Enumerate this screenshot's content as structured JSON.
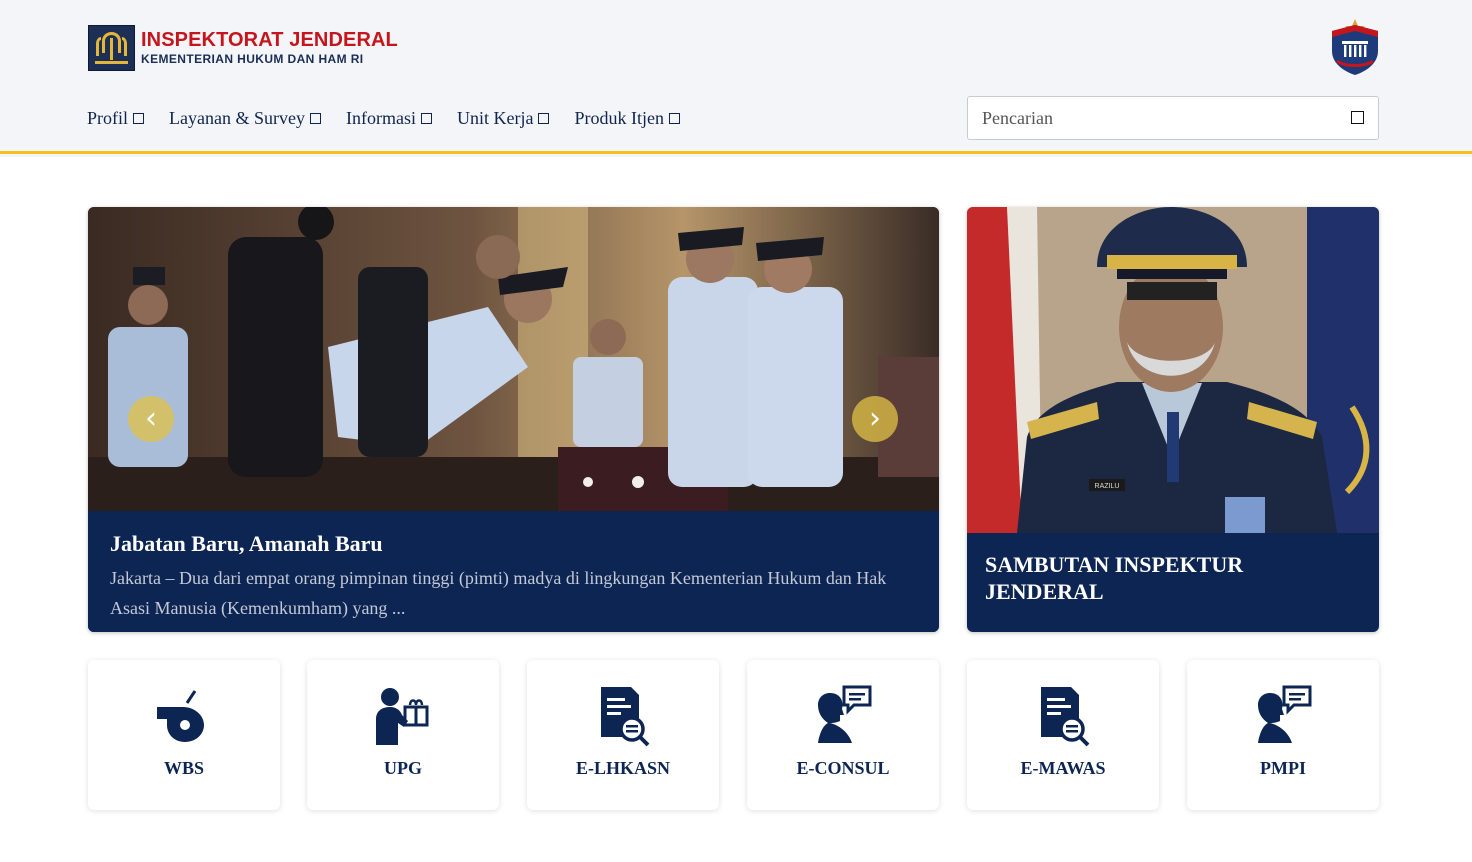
{
  "header": {
    "brand_title": "INSPEKTORAT JENDERAL",
    "brand_subtitle": "KEMENTERIAN HUKUM DAN HAM RI"
  },
  "nav": [
    {
      "label": "Profil"
    },
    {
      "label": "Layanan & Survey"
    },
    {
      "label": "Informasi"
    },
    {
      "label": "Unit Kerja"
    },
    {
      "label": "Produk Itjen"
    }
  ],
  "search": {
    "placeholder": "Pencarian",
    "value": ""
  },
  "hero": {
    "title": "Jabatan Baru, Amanah Baru",
    "excerpt": "Jakarta – Dua dari empat orang pimpinan tinggi (pimti) madya di lingkungan Kementerian Hukum dan Hak Asasi Manusia (Kemenkumham) yang ..."
  },
  "welcome": {
    "title": "SAMBUTAN INSPEKTUR JENDERAL",
    "name_tag": "RAZILU"
  },
  "services": [
    {
      "label": "WBS",
      "icon": "whistle-icon"
    },
    {
      "label": "UPG",
      "icon": "person-gift-icon"
    },
    {
      "label": "E-LHKASN",
      "icon": "document-search-icon"
    },
    {
      "label": "E-CONSUL",
      "icon": "person-chat-icon"
    },
    {
      "label": "E-MAWAS",
      "icon": "document-search-icon"
    },
    {
      "label": "PMPI",
      "icon": "person-chat-icon"
    }
  ],
  "colors": {
    "navy": "#0d2553",
    "brand_red": "#c4161c",
    "accent_yellow": "#f3c21a"
  }
}
